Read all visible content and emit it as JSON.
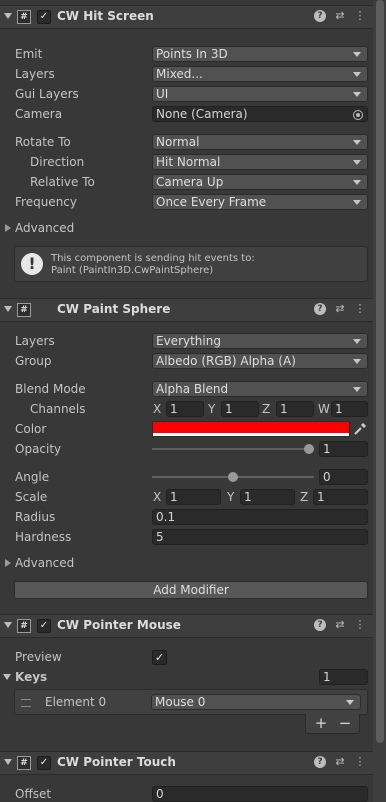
{
  "hit_screen": {
    "title": "CW Hit Screen",
    "fields": {
      "emit": {
        "label": "Emit",
        "value": "Points In 3D"
      },
      "layers": {
        "label": "Layers",
        "value": "Mixed..."
      },
      "gui_layers": {
        "label": "Gui Layers",
        "value": "UI"
      },
      "camera": {
        "label": "Camera",
        "value": "None (Camera)"
      },
      "rotate_to": {
        "label": "Rotate To",
        "value": "Normal"
      },
      "direction": {
        "label": "Direction",
        "value": "Hit Normal"
      },
      "relative_to": {
        "label": "Relative To",
        "value": "Camera Up"
      },
      "frequency": {
        "label": "Frequency",
        "value": "Once Every Frame"
      }
    },
    "advanced_label": "Advanced",
    "info_line1": "This component is sending hit events to:",
    "info_line2": "Paint (PaintIn3D.CwPaintSphere)"
  },
  "paint_sphere": {
    "title": "CW Paint Sphere",
    "layers": {
      "label": "Layers",
      "value": "Everything"
    },
    "group": {
      "label": "Group",
      "value": "Albedo (RGB) Alpha (A)"
    },
    "blend_mode": {
      "label": "Blend Mode",
      "value": "Alpha Blend"
    },
    "channels": {
      "label": "Channels",
      "x_label": "X",
      "x": "1",
      "y_label": "Y",
      "y": "1",
      "z_label": "Z",
      "z": "1",
      "w_label": "W",
      "w": "1"
    },
    "color": {
      "label": "Color",
      "hex": "#ff0000",
      "alpha": 1.0
    },
    "opacity": {
      "label": "Opacity",
      "value": "1",
      "fraction": 1.0
    },
    "angle": {
      "label": "Angle",
      "value": "0",
      "fraction": 0.5
    },
    "scale": {
      "label": "Scale",
      "x_label": "X",
      "x": "1",
      "y_label": "Y",
      "y": "1",
      "z_label": "Z",
      "z": "1"
    },
    "radius": {
      "label": "Radius",
      "value": "0.1"
    },
    "hardness": {
      "label": "Hardness",
      "value": "5"
    },
    "advanced_label": "Advanced",
    "add_modifier": "Add Modifier"
  },
  "pointer_mouse": {
    "title": "CW Pointer Mouse",
    "preview": {
      "label": "Preview",
      "checked": true
    },
    "keys": {
      "label": "Keys",
      "count": "1"
    },
    "element0": {
      "label": "Element 0",
      "value": "Mouse 0"
    },
    "add": "+",
    "remove": "−"
  },
  "pointer_touch": {
    "title": "CW Pointer Touch",
    "offset": {
      "label": "Offset",
      "value": "0"
    }
  },
  "glyphs": {
    "script": "#",
    "check": "✓",
    "question": "?",
    "presets": "⇄",
    "menu": "⋮"
  }
}
